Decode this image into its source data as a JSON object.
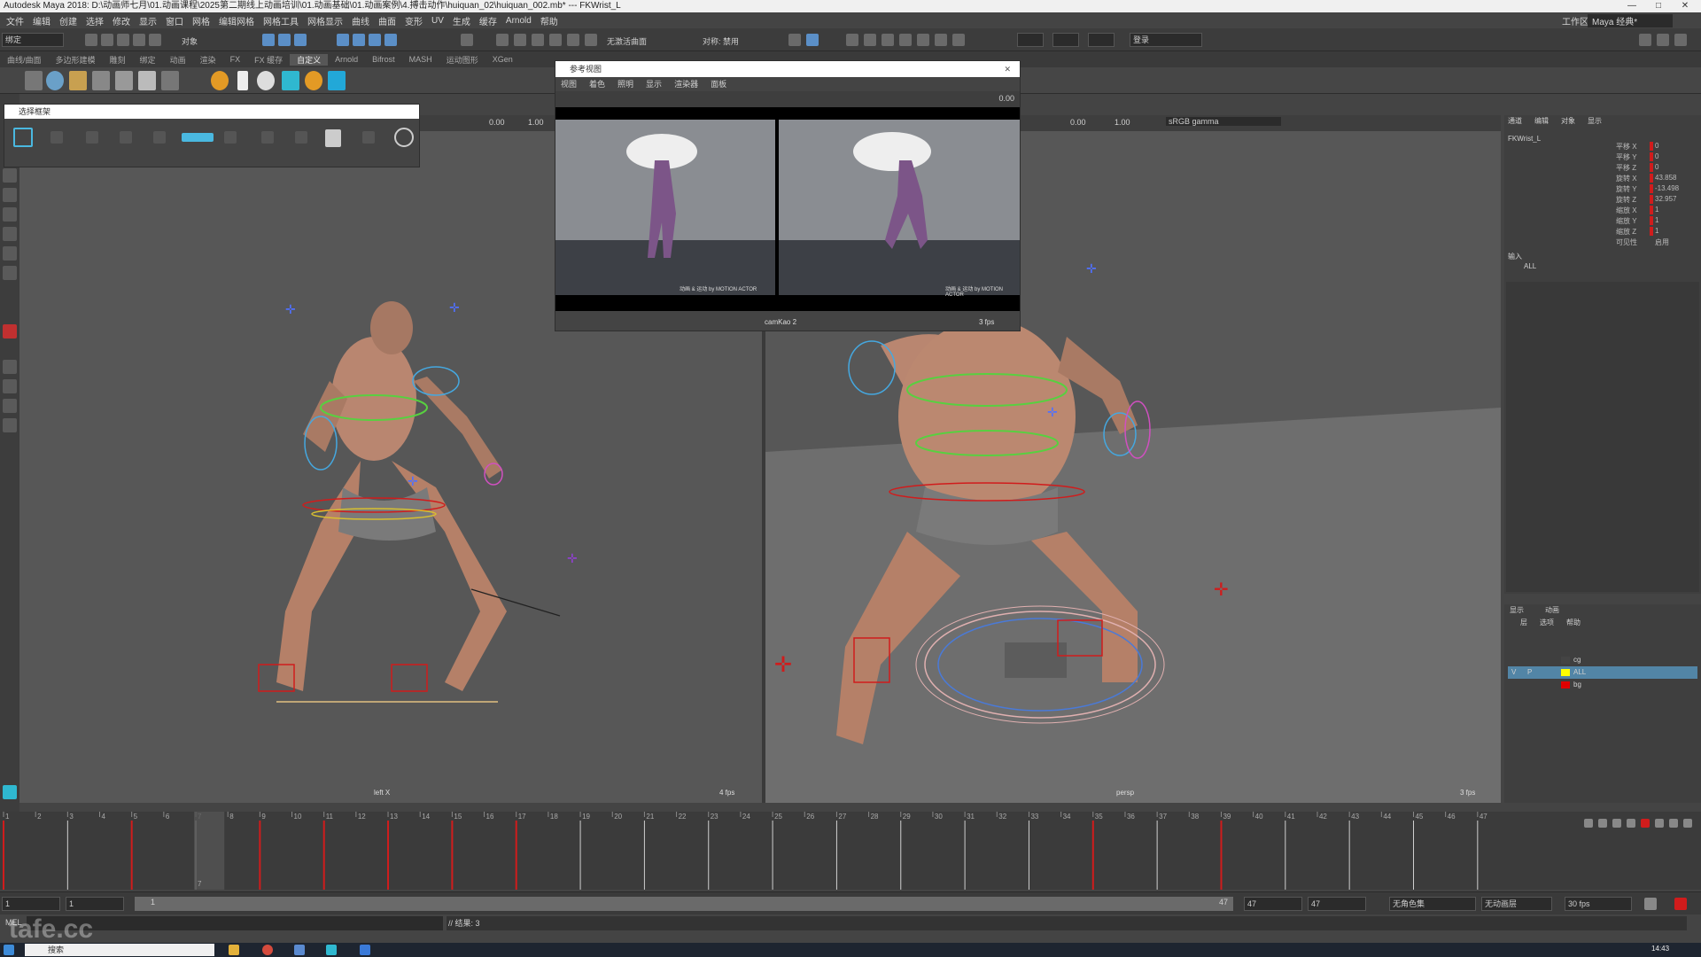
{
  "window": {
    "title": "Autodesk Maya 2018: D:\\动画师七月\\01.动画课程\\2025第二期线上动画培训\\01.动画基础\\01.动画案例\\4.搏击动作\\huiquan_02\\huiquan_002.mb* --- FKWrist_L",
    "min": "—",
    "max": "□",
    "close": "✕"
  },
  "menubar": {
    "items": [
      "文件",
      "编辑",
      "创建",
      "选择",
      "修改",
      "显示",
      "窗口",
      "网格",
      "编辑网格",
      "网格工具",
      "网格显示",
      "曲线",
      "曲面",
      "变形",
      "UV",
      "生成",
      "缓存",
      "Arnold",
      "帮助"
    ],
    "workspace_label": "工作区:",
    "workspace_value": "Maya 经典*"
  },
  "statusline": {
    "mode": "绑定",
    "obj_label": "对象",
    "symmetry": "无激活曲面",
    "sym_off": "对称: 禁用",
    "login": "登录"
  },
  "shelf": {
    "tabs": [
      "曲线/曲面",
      "多边形建模",
      "雕刻",
      "绑定",
      "动画",
      "渲染",
      "FX",
      "FX 缓存",
      "自定义",
      "Arnold",
      "Bifrost",
      "MASH",
      "运动图形",
      "XGen"
    ],
    "active_tab": "自定义",
    "buttons": [
      "大模组",
      "切换",
      "动作数据",
      "All",
      "a4ferag",
      "脚本编辑",
      "工具包"
    ]
  },
  "left_viewport": {
    "toolbar": {
      "val1": "0.00",
      "val2": "1.00"
    },
    "label": "left X",
    "fps": "4 fps"
  },
  "right_viewport": {
    "toolbar": {
      "val1": "0.00",
      "val2": "1.00",
      "colorspace": "sRGB gamma"
    },
    "label": "persp",
    "fps": "3 fps"
  },
  "outliner_float": {
    "title": "选择框架"
  },
  "ref_window": {
    "title": "参考视图",
    "menu": [
      "视图",
      "着色",
      "照明",
      "显示",
      "渲染器",
      "面板"
    ],
    "toolbar_value": "0.00",
    "watermark_left": "动画 & 运动 by MOTION ACTOR",
    "watermark_right": "动画 & 运动 by MOTION ACTOR",
    "camera_label": "camKao 2",
    "fps": "3 fps"
  },
  "channel_box": {
    "tabs": [
      "通道",
      "编辑",
      "对象",
      "显示"
    ],
    "object": "FKWrist_L",
    "channels": [
      {
        "name": "平移 X",
        "value": "0"
      },
      {
        "name": "平移 Y",
        "value": "0"
      },
      {
        "name": "平移 Z",
        "value": "0"
      },
      {
        "name": "旋转 X",
        "value": "43.858"
      },
      {
        "name": "旋转 Y",
        "value": "-13.498"
      },
      {
        "name": "旋转 Z",
        "value": "32.957"
      },
      {
        "name": "缩放 X",
        "value": "1"
      },
      {
        "name": "缩放 Y",
        "value": "1"
      },
      {
        "name": "缩放 Z",
        "value": "1"
      },
      {
        "name": "可见性",
        "value": "启用"
      }
    ],
    "inputs_label": "输入",
    "inputs_value": "ALL"
  },
  "layer_editor": {
    "tabs": [
      "显示",
      "动画"
    ],
    "menu": [
      "层",
      "选项",
      "帮助"
    ],
    "layers": [
      {
        "v": "",
        "p": "",
        "name": "cg",
        "color": "#444444",
        "selected": false
      },
      {
        "v": "V",
        "p": "P",
        "name": "ALL",
        "color": "#ffff00",
        "selected": true
      },
      {
        "v": "",
        "p": "",
        "name": "bg",
        "color": "#e00000",
        "selected": false
      }
    ]
  },
  "timeline": {
    "frames": [
      "1",
      "2",
      "3",
      "4",
      "5",
      "6",
      "7",
      "8",
      "9",
      "10",
      "11",
      "12",
      "13",
      "14",
      "15",
      "16",
      "17",
      "18",
      "19",
      "20",
      "21",
      "22",
      "23",
      "24",
      "25",
      "26",
      "27",
      "28",
      "29",
      "30",
      "31",
      "32",
      "33",
      "34",
      "35",
      "36",
      "37",
      "38",
      "39",
      "40",
      "41",
      "42",
      "43",
      "44",
      "45",
      "46",
      "47"
    ],
    "current_frame": "7",
    "keys": [
      1,
      3,
      5,
      7,
      9,
      11,
      13,
      15,
      17,
      19,
      21,
      23,
      25,
      27,
      29,
      31,
      33,
      35,
      37,
      39,
      41,
      43,
      45,
      47
    ],
    "red_keys": [
      1,
      5,
      9,
      11,
      13,
      15,
      17,
      22,
      28,
      35,
      39
    ],
    "current_frame_value": 7,
    "last_frame_value": 47
  },
  "range": {
    "start": "1",
    "start2": "1",
    "slider_label": "1",
    "end_inner": "47",
    "end": "47",
    "end2": "47",
    "char_set": "无角色集",
    "anim_layer": "无动画层",
    "fps": "30 fps"
  },
  "cmdline": {
    "mel": "MEL",
    "result": "// 结果: 3",
    "watermark": "tafe.cc"
  },
  "taskbar": {
    "search": "搜索",
    "time": "14:43"
  },
  "colors": {
    "accent_blue": "#5b8fc7",
    "key_red": "#d01c1c",
    "selected_layer": "#5285a6"
  }
}
